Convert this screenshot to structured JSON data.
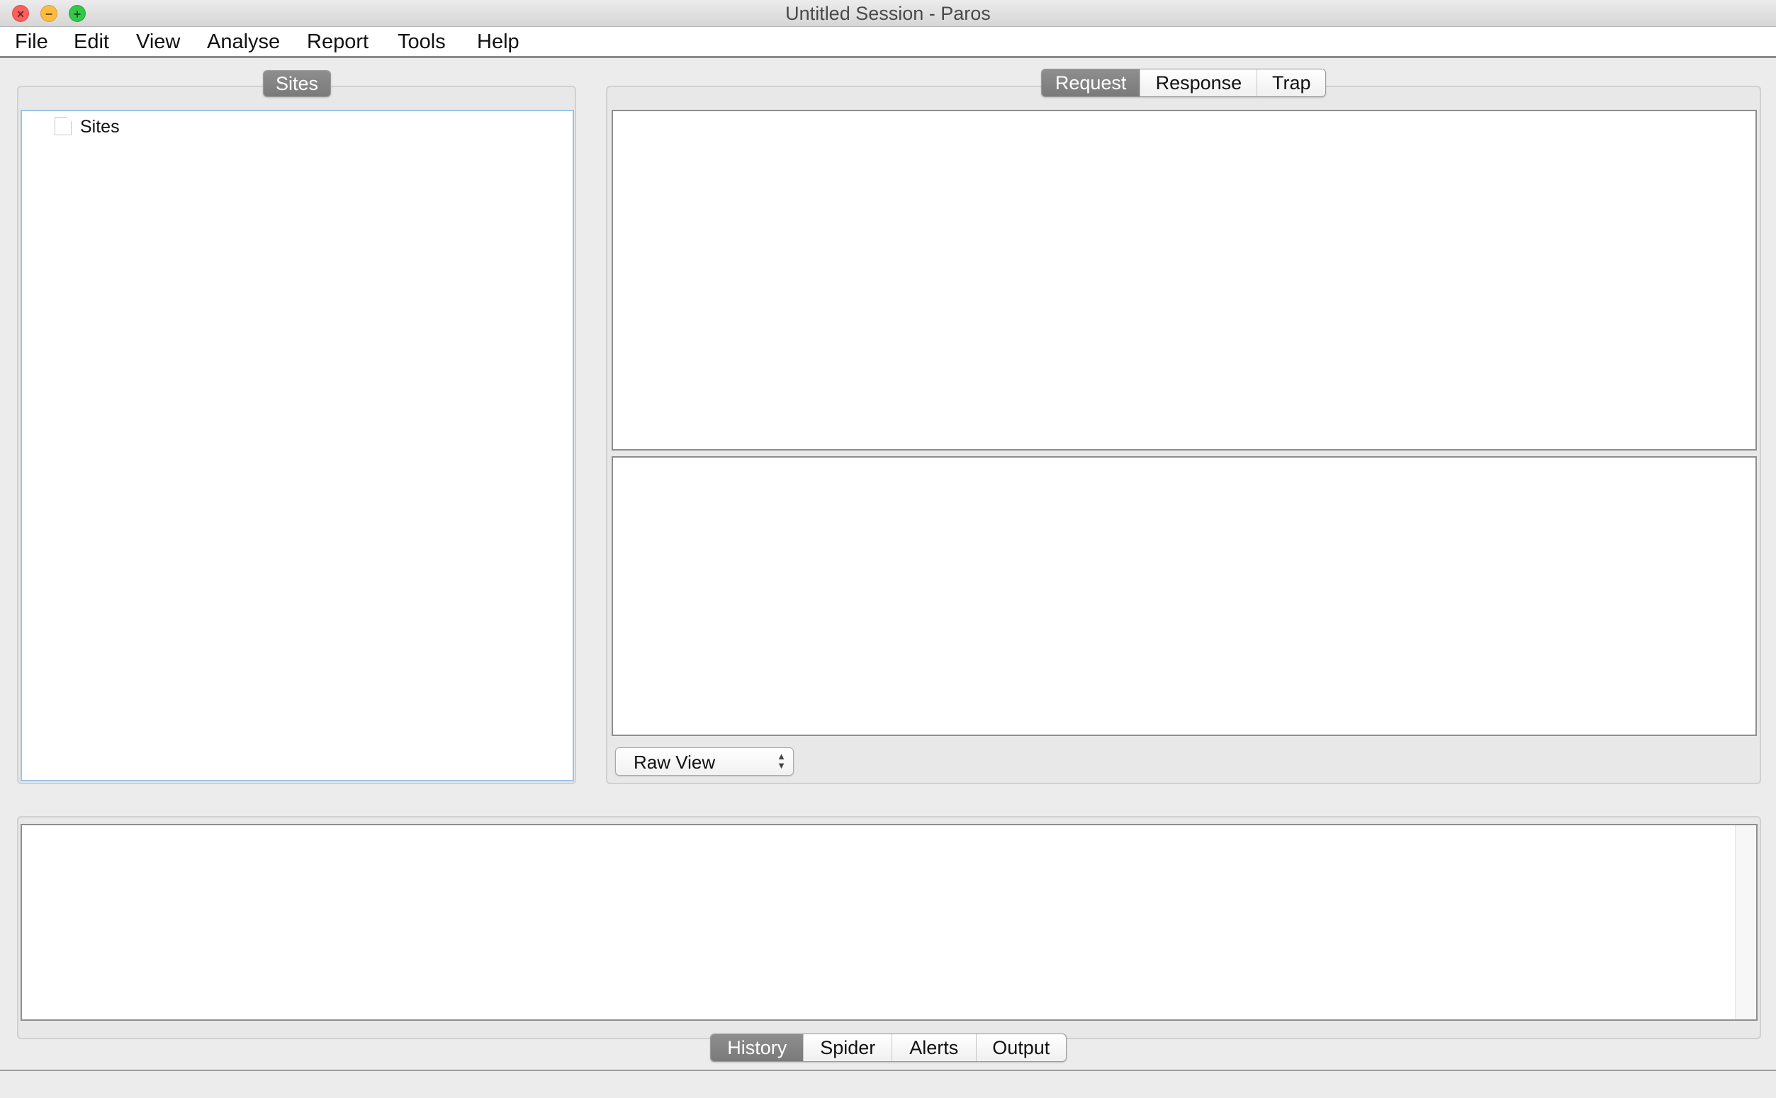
{
  "window": {
    "title": "Untitled Session - Paros",
    "controls": {
      "close": "close-icon",
      "minimize": "minimize-icon",
      "zoom": "zoom-icon"
    },
    "control_colors": {
      "close": "#fc605c",
      "minimize": "#fdbc40",
      "zoom": "#34c84a"
    }
  },
  "menu": [
    "File",
    "Edit",
    "View",
    "Analyse",
    "Report",
    "Tools",
    "Help"
  ],
  "sites_panel": {
    "tab": "Sites",
    "tree": [
      {
        "label": "Sites",
        "icon": "file-icon"
      }
    ]
  },
  "message_panel": {
    "tabs": [
      {
        "label": "Request",
        "active": true
      },
      {
        "label": "Response",
        "active": false
      },
      {
        "label": "Trap",
        "active": false
      }
    ],
    "view_select": "Raw View"
  },
  "bottom_panel": {
    "tabs": [
      {
        "label": "History",
        "active": true
      },
      {
        "label": "Spider",
        "active": false
      },
      {
        "label": "Alerts",
        "active": false
      },
      {
        "label": "Output",
        "active": false
      }
    ]
  }
}
